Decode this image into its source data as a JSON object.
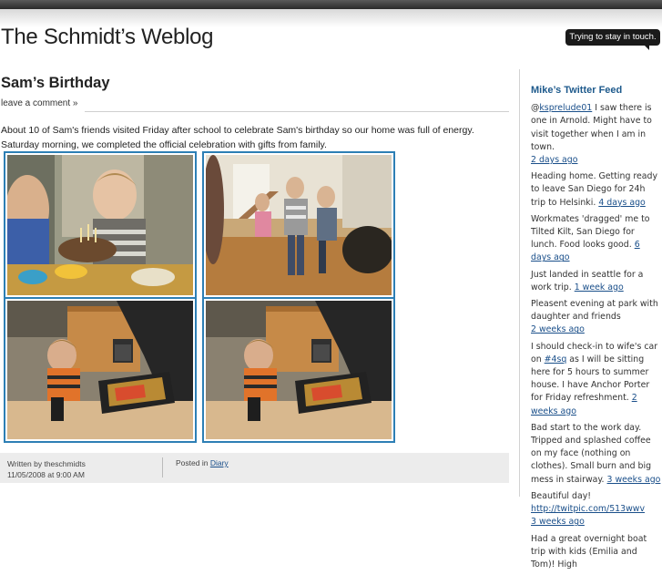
{
  "site": {
    "title": "The Schmidt’s Weblog",
    "tagline": "Trying to stay in touch."
  },
  "post": {
    "title": "Sam’s Birthday",
    "leave_comment": "leave a comment »",
    "body_line1": "About 10 of Sam's friends visited Friday after school to celebrate Sam's birthday so our home was full of energy.",
    "body_line2": "Saturday morning, we completed the official celebration with gifts from family.",
    "meta": {
      "written_by": "Written by theschmidts",
      "date": "11/05/2008 at 9:00 AM",
      "posted_in_label": "Posted in",
      "category": "Diary"
    }
  },
  "sidebar": {
    "title": "Mike’s Twitter Feed",
    "tweets": [
      {
        "pre": "@",
        "link": "ksprelude01",
        "text": " I saw there is one in Arnold. Might have to visit together when I am in town.",
        "time": "2 days ago"
      },
      {
        "pre": "",
        "link": "",
        "text": "Heading home. Getting ready to leave San Diego for 24h trip to Helsinki. ",
        "time": "4 days ago"
      },
      {
        "pre": "",
        "link": "",
        "text": "Workmates 'dragged' me to Tilted Kilt, San Diego for lunch. Food looks good. ",
        "time": "6 days ago"
      },
      {
        "pre": "",
        "link": "",
        "text": "Just landed in seattle for a work trip. ",
        "time": "1 week ago"
      },
      {
        "pre": "",
        "link": "",
        "text": "Pleasent evening at park with daughter and friends",
        "time": "2 weeks ago"
      },
      {
        "pre": "I should check-in to wife's car on ",
        "link": "#4sq",
        "text": " as I will be sitting here for 5 hours to summer house. I have Anchor Porter for Friday refreshment. ",
        "time": "2 weeks ago"
      },
      {
        "pre": "",
        "link": "",
        "text": "Bad start to the work day. Tripped and splashed coffee on my face (nothing on clothes). Small burn and big mess in stairway. ",
        "time": "3 weeks ago"
      },
      {
        "pre": "Beautiful day! ",
        "link": "http://twitpic.com/513wwv",
        "text": "",
        "time": "3 weeks ago"
      },
      {
        "pre": "",
        "link": "",
        "text": "Had a great overnight boat trip with kids (Emilia and Tom)! High",
        "time": ""
      }
    ]
  },
  "colors": {
    "photo_border": "#2d7fb5",
    "link": "#1a4f8a",
    "sidebar_heading": "#1e5a8c"
  }
}
